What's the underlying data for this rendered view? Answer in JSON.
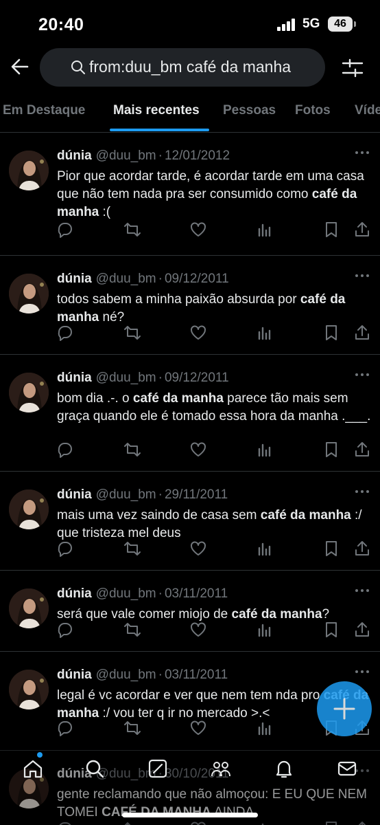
{
  "status_bar": {
    "time": "20:40",
    "network": "5G",
    "battery": "46"
  },
  "search": {
    "query": "from:duu_bm café da manha"
  },
  "tabs": [
    {
      "label": "Em Destaque",
      "active": false
    },
    {
      "label": "Mais recentes",
      "active": true
    },
    {
      "label": "Pessoas",
      "active": false
    },
    {
      "label": "Fotos",
      "active": false
    },
    {
      "label": "Víde",
      "active": false
    }
  ],
  "tweets": [
    {
      "name": "dúnia",
      "handle": "@duu_bm",
      "date": "12/01/2012",
      "text_html": "Pior que acordar tarde, é acordar tarde em uma casa que não tem nada pra ser consumido como <b>café da manha</b> :("
    },
    {
      "name": "dúnia",
      "handle": "@duu_bm",
      "date": "09/12/2011",
      "text_html": "todos sabem a minha paixão absurda por <b>café da manha</b> né?"
    },
    {
      "name": "dúnia",
      "handle": "@duu_bm",
      "date": "09/12/2011",
      "text_html": "bom dia .-. o <b>café da manha</b> parece tão mais sem graça quando ele é tomado essa hora da manha .___."
    },
    {
      "name": "dúnia",
      "handle": "@duu_bm",
      "date": "29/11/2011",
      "text_html": "mais uma vez saindo de casa sem <b>café da manha</b> :/ que tristeza mel deus"
    },
    {
      "name": "dúnia",
      "handle": "@duu_bm",
      "date": "03/11/2011",
      "text_html": "será que vale comer miojo de <b>café da manha</b>?"
    },
    {
      "name": "dúnia",
      "handle": "@duu_bm",
      "date": "03/11/2011",
      "text_html": "legal é vc acordar e ver que nem tem nda pro <b>café da manha</b> :/ vou ter q ir no mercado &gt;.&lt;"
    },
    {
      "name": "dúnia",
      "handle": "@duu_bm",
      "date": "30/10/2011",
      "text_html": "gente reclamando que não almoçou: E EU QUE NEM TOMEI <b>CAFÉ DA MANHA</b> AINDA"
    }
  ],
  "icons": [
    "back-arrow-icon",
    "search-icon",
    "filter-icon",
    "reply-icon",
    "retweet-icon",
    "like-icon",
    "views-icon",
    "bookmark-icon",
    "share-icon",
    "more-icon",
    "compose-icon",
    "home-icon",
    "explore-icon",
    "grok-icon",
    "communities-icon",
    "notifications-icon",
    "messages-icon"
  ],
  "colors": {
    "accent": "#1d9bf0",
    "background": "#000000",
    "muted": "#71767b",
    "divider": "#2f3336"
  }
}
